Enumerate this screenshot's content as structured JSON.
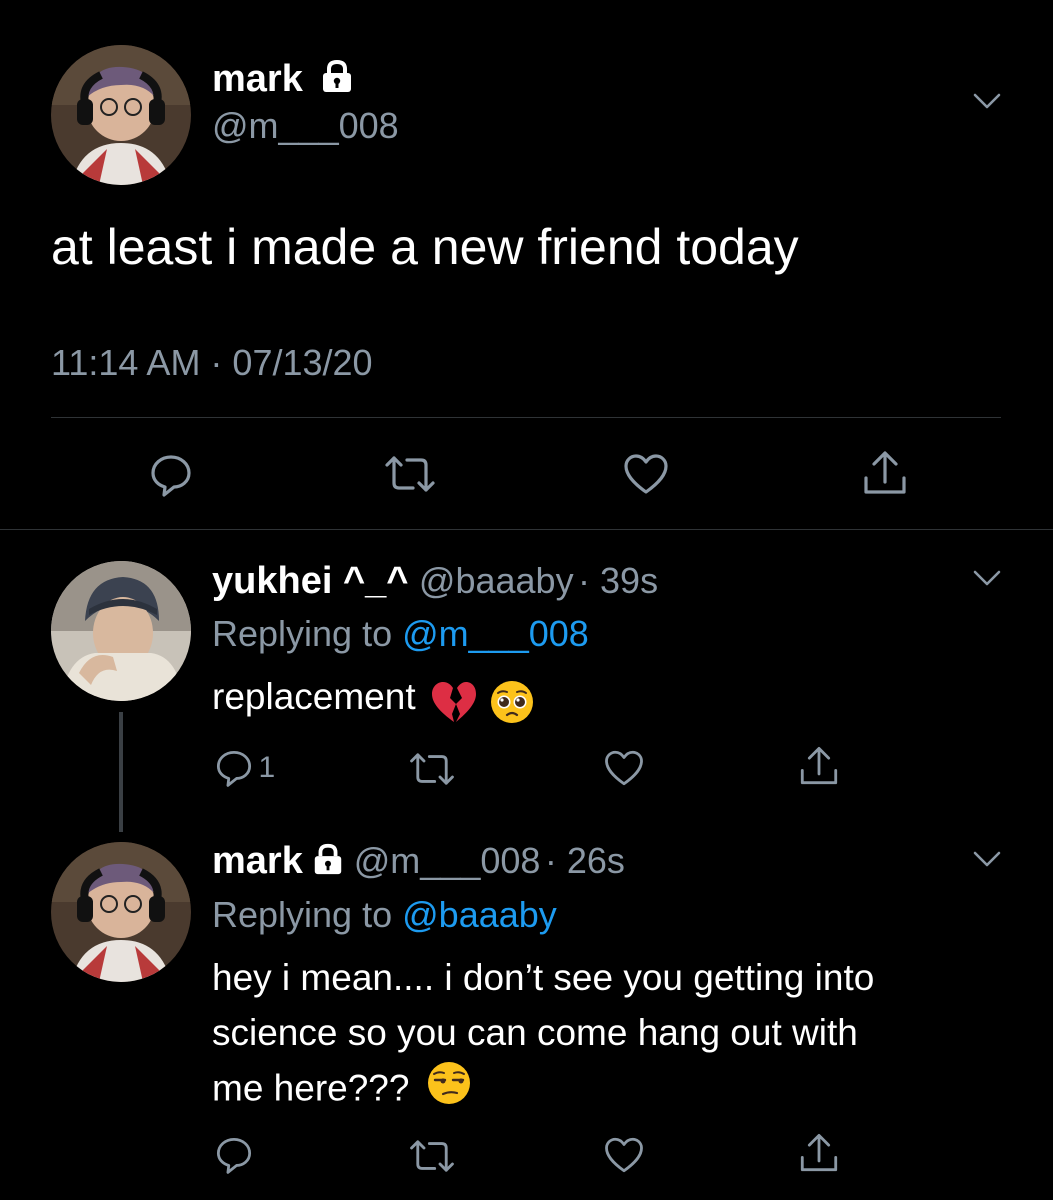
{
  "main_tweet": {
    "author_name": "mark",
    "author_handle": "@m___008",
    "text": "at least i made a new friend today",
    "timestamp": "11:14 AM · 07/13/20"
  },
  "replies": [
    {
      "author_name": "yukhei ^_^",
      "author_handle": "@baaaby",
      "time": "· 39s",
      "replying_prefix": "Replying to",
      "replying_to": "@m___008",
      "text": "replacement",
      "emojis": [
        "broken-heart",
        "pleading-face"
      ],
      "reply_count": "1"
    },
    {
      "author_name": "mark",
      "author_handle": "@m___008",
      "time": "· 26s",
      "replying_prefix": "Replying to",
      "replying_to": "@baaaby",
      "text_lines": [
        "hey i mean.... i don’t see you getting into",
        "science so you can come hang out with",
        "me here???"
      ],
      "emojis": [
        "unamused-face"
      ]
    }
  ],
  "icons": {
    "lock": "lock-icon",
    "chevron": "chevron-down-icon",
    "reply": "reply-icon",
    "retweet": "retweet-icon",
    "like": "heart-icon",
    "share": "share-icon"
  },
  "colors": {
    "background": "#000000",
    "text": "#ffffff",
    "muted": "#8b98a5",
    "link": "#1d9bf0",
    "divider": "#2f3336"
  }
}
